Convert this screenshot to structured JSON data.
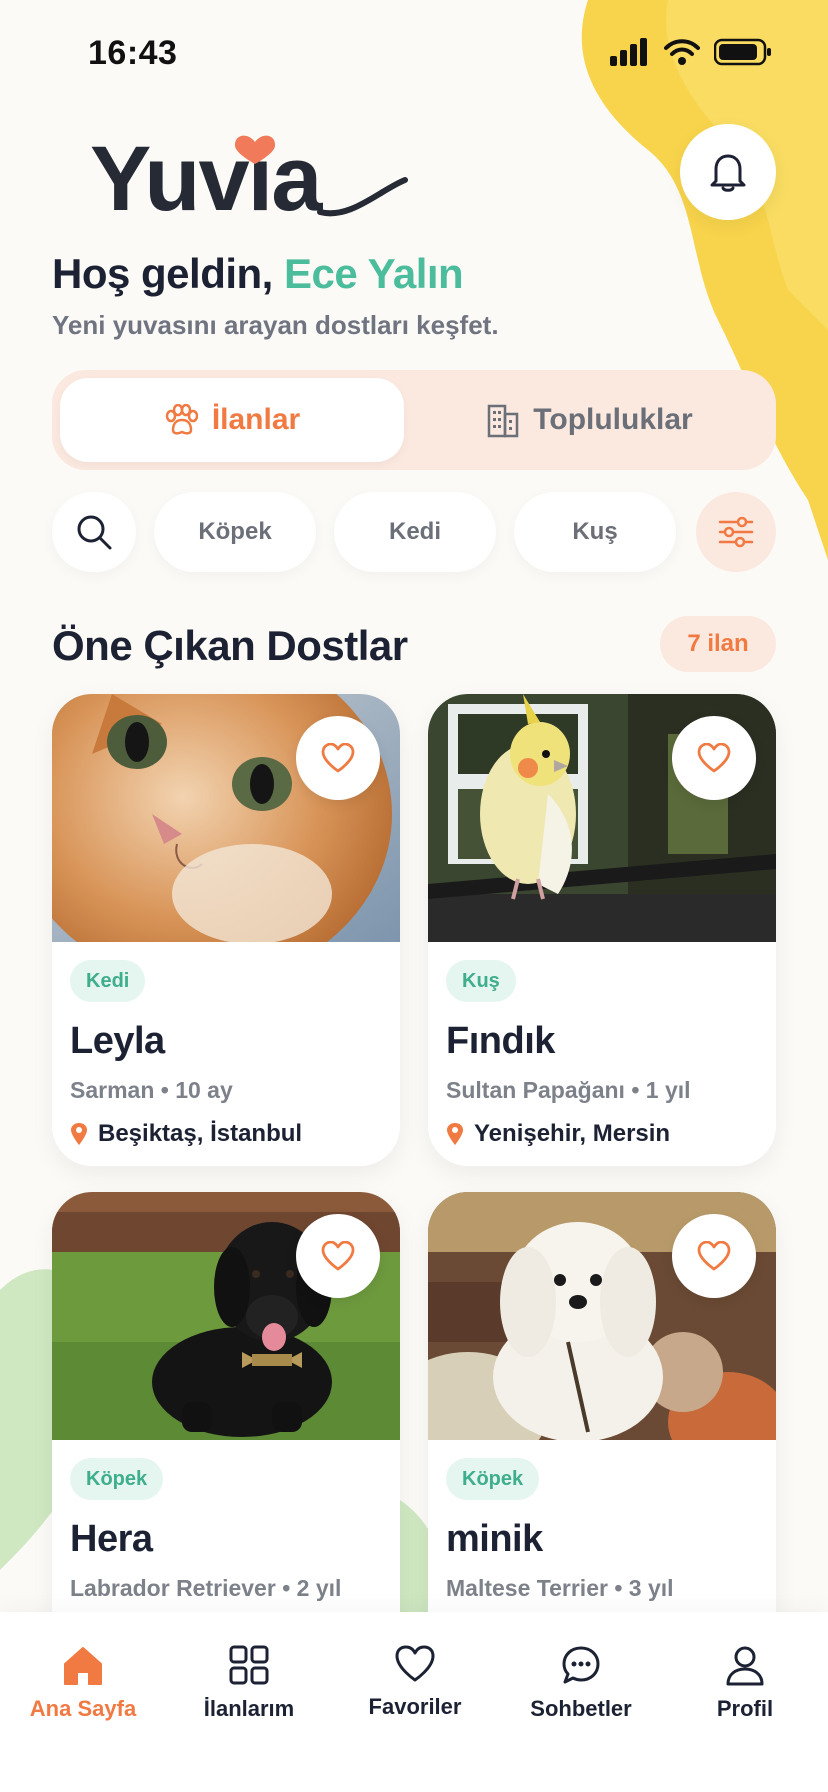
{
  "status": {
    "time": "16:43"
  },
  "app": {
    "logo_text": "Yuvia"
  },
  "greeting": {
    "prefix": "Hoş geldin, ",
    "name": "Ece Yalın",
    "subtitle": "Yeni yuvasını arayan dostları keşfet."
  },
  "tabs": [
    {
      "label": "İlanlar",
      "icon": "paw-icon",
      "active": true
    },
    {
      "label": "Topluluklar",
      "icon": "building-icon",
      "active": false
    }
  ],
  "filters": {
    "chips": [
      "Köpek",
      "Kedi",
      "Kuş"
    ]
  },
  "section": {
    "title": "Öne Çıkan Dostlar",
    "count_label": "7 ilan"
  },
  "pets": [
    {
      "tag": "Kedi",
      "name": "Leyla",
      "meta": "Sarman • 10 ay",
      "location": "Beşiktaş, İstanbul"
    },
    {
      "tag": "Kuş",
      "name": "Fındık",
      "meta": "Sultan Papağanı • 1 yıl",
      "location": "Yenişehir, Mersin"
    },
    {
      "tag": "Köpek",
      "name": "Hera",
      "meta": "Labrador Retriever • 2 yıl",
      "location": ""
    },
    {
      "tag": "Köpek",
      "name": "minik",
      "meta": "Maltese Terrier • 3 yıl",
      "location": ""
    }
  ],
  "nav": [
    {
      "label": "Ana Sayfa",
      "icon": "home-icon",
      "active": true
    },
    {
      "label": "İlanlarım",
      "icon": "grid-icon",
      "active": false
    },
    {
      "label": "Favoriler",
      "icon": "heart-icon",
      "active": false
    },
    {
      "label": "Sohbetler",
      "icon": "chat-icon",
      "active": false
    },
    {
      "label": "Profil",
      "icon": "user-icon",
      "active": false
    }
  ],
  "colors": {
    "accent": "#f07a42",
    "green": "#4bbd9c",
    "yellow": "#f7d24a",
    "text": "#1c2233"
  }
}
